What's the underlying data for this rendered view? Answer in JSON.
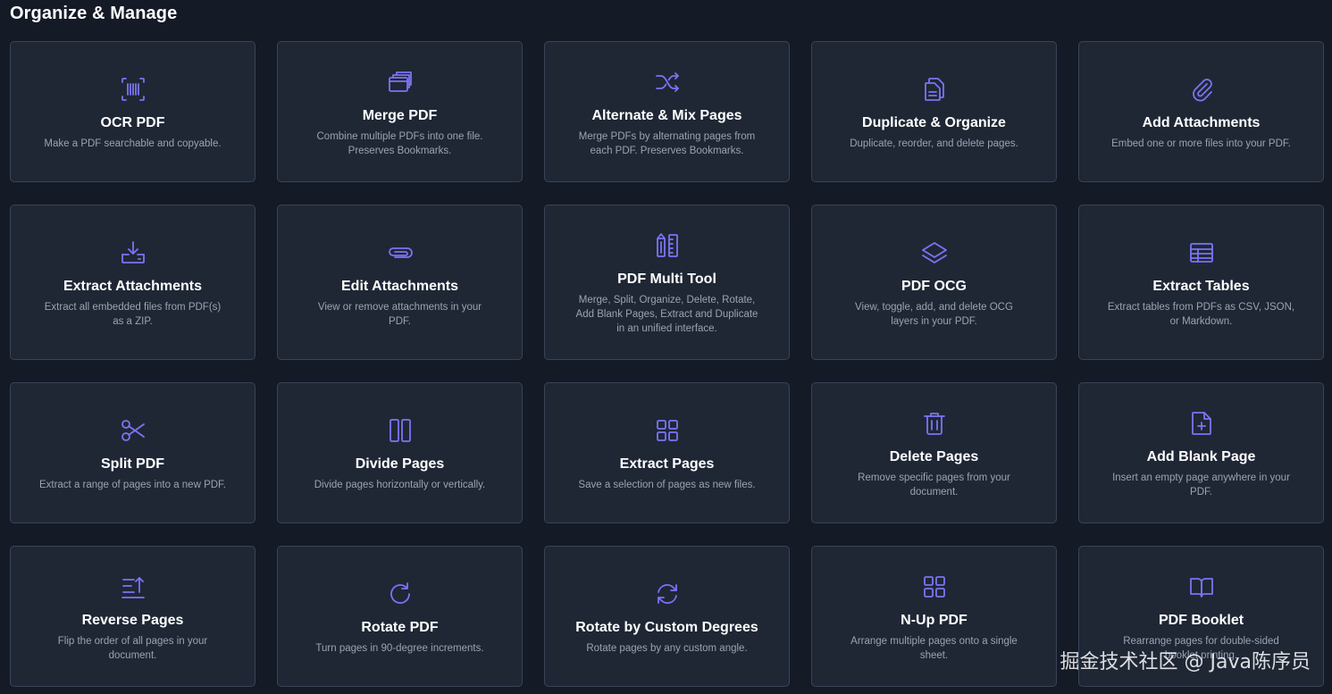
{
  "section": {
    "title": "Organize & Manage"
  },
  "cards": [
    {
      "icon": "ocr-scan-icon",
      "title": "OCR PDF",
      "desc": "Make a PDF searchable and copyable."
    },
    {
      "icon": "stack-pages-icon",
      "title": "Merge PDF",
      "desc": "Combine multiple PDFs into one file. Preserves Bookmarks."
    },
    {
      "icon": "shuffle-icon",
      "title": "Alternate & Mix Pages",
      "desc": "Merge PDFs by alternating pages from each PDF. Preserves Bookmarks."
    },
    {
      "icon": "duplicate-document-icon",
      "title": "Duplicate & Organize",
      "desc": "Duplicate, reorder, and delete pages."
    },
    {
      "icon": "paperclip-icon",
      "title": "Add Attachments",
      "desc": "Embed one or more files into your PDF."
    },
    {
      "icon": "download-tray-icon",
      "title": "Extract Attachments",
      "desc": "Extract all embedded files from PDF(s) as a ZIP."
    },
    {
      "icon": "attachment-icon",
      "title": "Edit Attachments",
      "desc": "View or remove attachments in your PDF."
    },
    {
      "icon": "tools-icon",
      "title": "PDF Multi Tool",
      "desc": "Merge, Split, Organize, Delete, Rotate, Add Blank Pages, Extract and Duplicate in an unified interface."
    },
    {
      "icon": "layers-icon",
      "title": "PDF OCG",
      "desc": "View, toggle, add, and delete OCG layers in your PDF."
    },
    {
      "icon": "table-icon",
      "title": "Extract Tables",
      "desc": "Extract tables from PDFs as CSV, JSON, or Markdown."
    },
    {
      "icon": "scissors-icon",
      "title": "Split PDF",
      "desc": "Extract a range of pages into a new PDF."
    },
    {
      "icon": "columns-icon",
      "title": "Divide Pages",
      "desc": "Divide pages horizontally or vertically."
    },
    {
      "icon": "grid-icon",
      "title": "Extract Pages",
      "desc": "Save a selection of pages as new files."
    },
    {
      "icon": "trash-icon",
      "title": "Delete Pages",
      "desc": "Remove specific pages from your document."
    },
    {
      "icon": "file-plus-icon",
      "title": "Add Blank Page",
      "desc": "Insert an empty page anywhere in your PDF."
    },
    {
      "icon": "sort-reverse-icon",
      "title": "Reverse Pages",
      "desc": "Flip the order of all pages in your document."
    },
    {
      "icon": "rotate-cw-icon",
      "title": "Rotate PDF",
      "desc": "Turn pages in 90-degree increments."
    },
    {
      "icon": "refresh-icon",
      "title": "Rotate by Custom Degrees",
      "desc": "Rotate pages by any custom angle."
    },
    {
      "icon": "grid-icon",
      "title": "N-Up PDF",
      "desc": "Arrange multiple pages onto a single sheet."
    },
    {
      "icon": "book-open-icon",
      "title": "PDF Booklet",
      "desc": "Rearrange pages for double-sided booklet printing."
    }
  ],
  "watermark": "掘金技术社区 @ Java陈序员"
}
